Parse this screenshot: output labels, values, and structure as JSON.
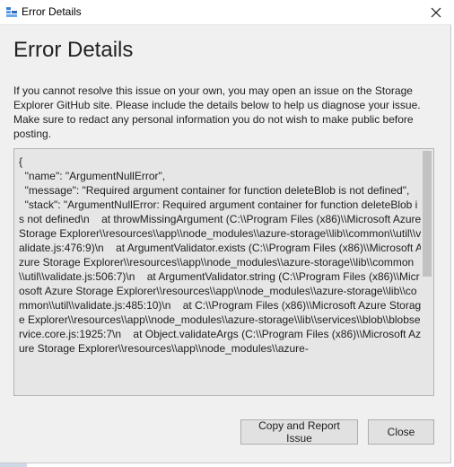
{
  "window": {
    "title": "Error Details",
    "close_icon": "close-icon",
    "app_icon": "storage-explorer-icon"
  },
  "content": {
    "heading": "Error Details",
    "description": "If you cannot resolve this issue on your own, you may open an issue on the Storage Explorer GitHub site. Please include the details below to help us diagnose your issue. Make sure to redact any personal information you do not wish to make public before posting.",
    "error_details": "{\n  \"name\": \"ArgumentNullError\",\n  \"message\": \"Required argument container for function deleteBlob is not defined\",\n  \"stack\": \"ArgumentNullError: Required argument container for function deleteBlob is not defined\\n    at throwMissingArgument (C:\\\\Program Files (x86)\\\\Microsoft Azure Storage Explorer\\\\resources\\\\app\\\\node_modules\\\\azure-storage\\\\lib\\\\common\\\\util\\\\validate.js:476:9)\\n    at ArgumentValidator.exists (C:\\\\Program Files (x86)\\\\Microsoft Azure Storage Explorer\\\\resources\\\\app\\\\node_modules\\\\azure-storage\\\\lib\\\\common\\\\util\\\\validate.js:506:7)\\n    at ArgumentValidator.string (C:\\\\Program Files (x86)\\\\Microsoft Azure Storage Explorer\\\\resources\\\\app\\\\node_modules\\\\azure-storage\\\\lib\\\\common\\\\util\\\\validate.js:485:10)\\n    at C:\\\\Program Files (x86)\\\\Microsoft Azure Storage Explorer\\\\resources\\\\app\\\\node_modules\\\\azure-storage\\\\lib\\\\services\\\\blob\\\\blobservice.core.js:1925:7\\n    at Object.validateArgs (C:\\\\Program Files (x86)\\\\Microsoft Azure Storage Explorer\\\\resources\\\\app\\\\node_modules\\\\azure-"
  },
  "buttons": {
    "copy_report_label": "Copy and Report Issue",
    "close_label": "Close"
  },
  "colors": {
    "dialog_background": "#f0f0f0",
    "details_background": "#e6e6e6",
    "button_background": "#e1e1e1",
    "button_border": "#adadad",
    "scroll_thumb": "#c2c2c2"
  }
}
